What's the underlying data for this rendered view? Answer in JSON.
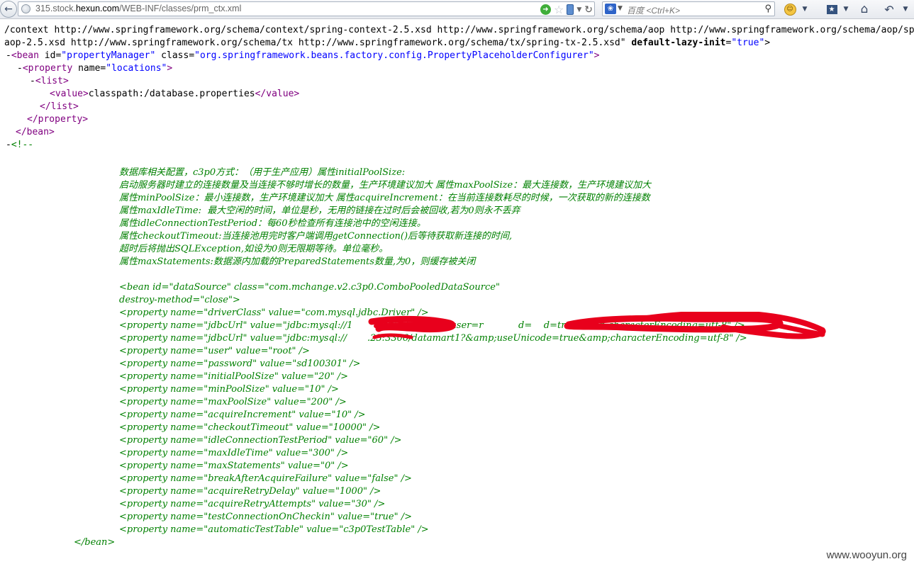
{
  "toolbar": {
    "url_prefix": "315.stock.",
    "url_domain": "hexun.com",
    "url_path": "/WEB-INF/classes/prm_ctx.xml",
    "search_engine": "百度",
    "search_placeholder": "<Ctrl+K>"
  },
  "xml": {
    "header_line1": "/context http://www.springframework.org/schema/context/spring-context-2.5.xsd http://www.springframework.org/schema/aop http://www.springframework.org/schema/aop/spring-",
    "header_line2_text": "aop-2.5.xsd http://www.springframework.org/schema/tx http://www.springframework.org/schema/tx/spring-tx-2.5.xsd\"",
    "header_line2_attr": "default-lazy-init",
    "header_line2_val": "\"true\"",
    "bean_open": {
      "toggle": "-",
      "tag": "bean",
      "id_attr": "id",
      "id_val": "\"propertyManager\"",
      "class_attr": "class",
      "class_val": "\"org.springframework.beans.factory.config.PropertyPlaceholderConfigurer\""
    },
    "property_open": {
      "toggle": "-",
      "tag": "property",
      "attr": "name",
      "val": "\"locations\""
    },
    "list_open": {
      "toggle": "-",
      "tag": "list"
    },
    "value_line": {
      "tag": "value",
      "text": "classpath:/database.properties"
    },
    "list_close": "list",
    "property_close": "property",
    "bean_close": "bean",
    "comment_open": {
      "toggle": "-",
      "text": "<!--"
    },
    "comment_lines": [
      "数据库相关配置，c3p0方式：（用于生产应用）属性initialPoolSize:",
      "启动服务器时建立的连接数量及当连接不够时增长的数量，生产环境建议加大 属性maxPoolSize：最大连接数，生产环境建议加大",
      "属性minPoolSize：最小连接数，生产环境建议加大 属性acquireIncrement：在当前连接数耗尽的时候，一次获取的新的连接数",
      "属性maxIdleTime:  最大空闲的时间，单位是秒，无用的链接在过时后会被回收,若为0则永不丢弃",
      "属性idleConnectionTestPeriod：每60秒检查所有连接池中的空闲连接。",
      "属性checkoutTimeout:当连接池用完时客户端调用getConnection()后等待获取新连接的时间,",
      "超时后将抛出SQLException,如设为0则无限期等待。单位毫秒。",
      "属性maxStatements:数据源内加载的PreparedStatements数量,为0，则缓存被关闭"
    ],
    "bean_lines": [
      "<bean id=\"dataSource\" class=\"com.mchange.v2.c3p0.ComboPooledDataSource\"",
      "destroy-method=\"close\">",
      "<property name=\"driverClass\" value=\"com.mysql.jdbc.Driver\" />",
      "<property name=\"jdbcUrl\" value=\"jdbc:mysql://1        3306/datamart?user=r            d=    d=true&amp;characterEncoding=utf-8\" />",
      "<property name=\"jdbcUrl\" value=\"jdbc:mysql://       .23:3306/datamart1?&amp;useUnicode=true&amp;characterEncoding=utf-8\" />",
      "<property name=\"user\" value=\"root\" />",
      "<property name=\"password\" value=\"sd100301\" />",
      "<property name=\"initialPoolSize\" value=\"20\" />",
      "<property name=\"minPoolSize\" value=\"10\" />",
      "<property name=\"maxPoolSize\" value=\"200\" />",
      "<property name=\"acquireIncrement\" value=\"10\" />",
      "<property name=\"checkoutTimeout\" value=\"10000\" />",
      "<property name=\"idleConnectionTestPeriod\" value=\"60\" />",
      "<property name=\"maxIdleTime\" value=\"300\" />",
      "<property name=\"maxStatements\" value=\"0\" />",
      "<property name=\"breakAfterAcquireFailure\" value=\"false\" />",
      "<property name=\"acquireRetryDelay\" value=\"1000\" />",
      "<property name=\"acquireRetryAttempts\" value=\"30\" />",
      "<property name=\"testConnectionOnCheckin\" value=\"true\" />",
      "<property name=\"automaticTestTable\" value=\"c3p0TestTable\" />"
    ],
    "bean_end": "</bean>"
  },
  "watermark": "www.wooyun.org"
}
